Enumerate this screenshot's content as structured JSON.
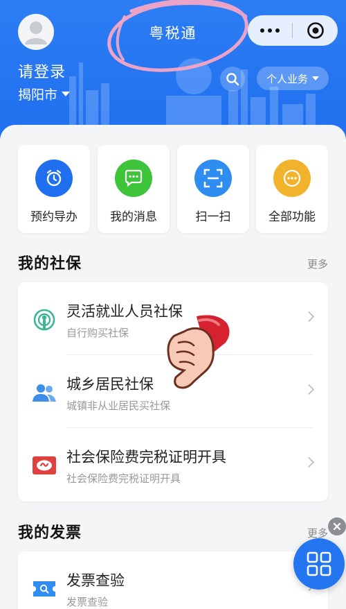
{
  "header": {
    "title": "粤税通",
    "login_text": "请登录",
    "city": "揭阳市",
    "personal_business": "个人业务"
  },
  "quick_actions": [
    {
      "label": "预约导办",
      "icon": "alarm-clock-icon",
      "color": "#1f6fef"
    },
    {
      "label": "我的消息",
      "icon": "chat-bubble-icon",
      "color": "#3dc43a"
    },
    {
      "label": "扫一扫",
      "icon": "scan-icon",
      "color": "#2f8df2"
    },
    {
      "label": "全部功能",
      "icon": "more-dots-icon",
      "color": "#f2b32c"
    }
  ],
  "social_security": {
    "title": "我的社保",
    "more": "更多",
    "items": [
      {
        "title": "灵活就业人员社保",
        "subtitle": "自行购买社保",
        "icon": "flexible-worker-icon"
      },
      {
        "title": "城乡居民社保",
        "subtitle": "城镇非从业居民买社保",
        "icon": "residents-icon"
      },
      {
        "title": "社会保险费完税证明开具",
        "subtitle": "社会保险费完税证明开具",
        "icon": "tax-certificate-icon"
      }
    ]
  },
  "invoices": {
    "title": "我的发票",
    "more": "更多",
    "items": [
      {
        "title": "发票查验",
        "subtitle": "发票查验",
        "icon": "invoice-check-icon"
      }
    ]
  },
  "colors": {
    "header_blue": "#2d7df4",
    "accent_blue": "#2476f0"
  }
}
